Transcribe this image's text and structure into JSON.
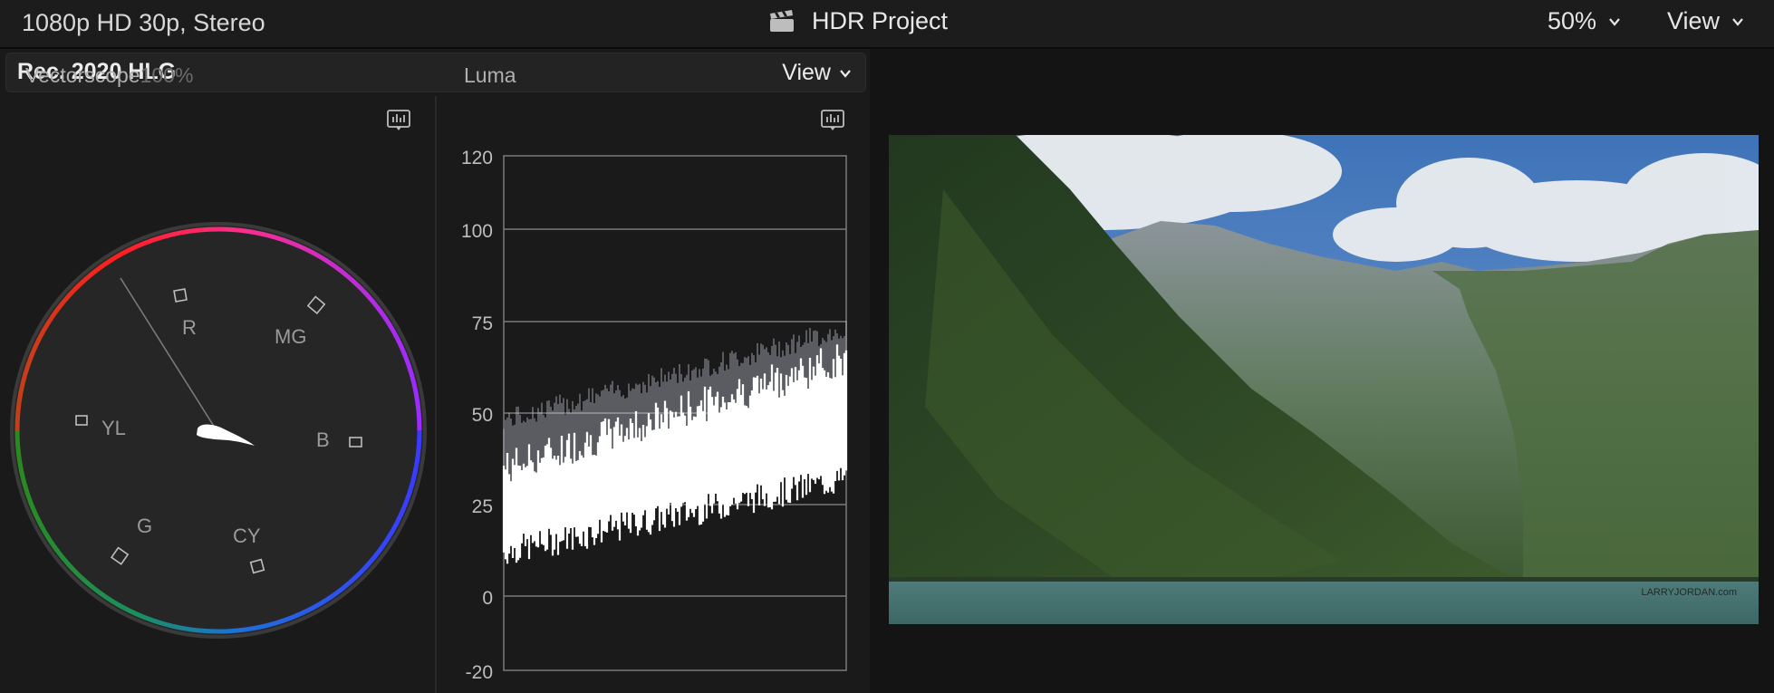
{
  "topbar": {
    "format": "1080p HD 30p, Stereo",
    "project_title": "HDR Project",
    "zoom": "50%",
    "view_label": "View"
  },
  "scopes": {
    "colorspace": "Rec. 2020 HLG",
    "view_label": "View",
    "vectorscope": {
      "title": "Vectorscope",
      "percent": "100%",
      "targets": [
        "R",
        "MG",
        "B",
        "CY",
        "G",
        "YL"
      ]
    },
    "waveform": {
      "title": "Luma",
      "ticks": [
        "120",
        "100",
        "75",
        "50",
        "25",
        "0",
        "-20"
      ]
    }
  },
  "viewer": {
    "watermark": "LARRYJORDAN.com",
    "icons": [
      "clapper-icon",
      "scope-settings-icon",
      "chevron-down-icon"
    ]
  }
}
